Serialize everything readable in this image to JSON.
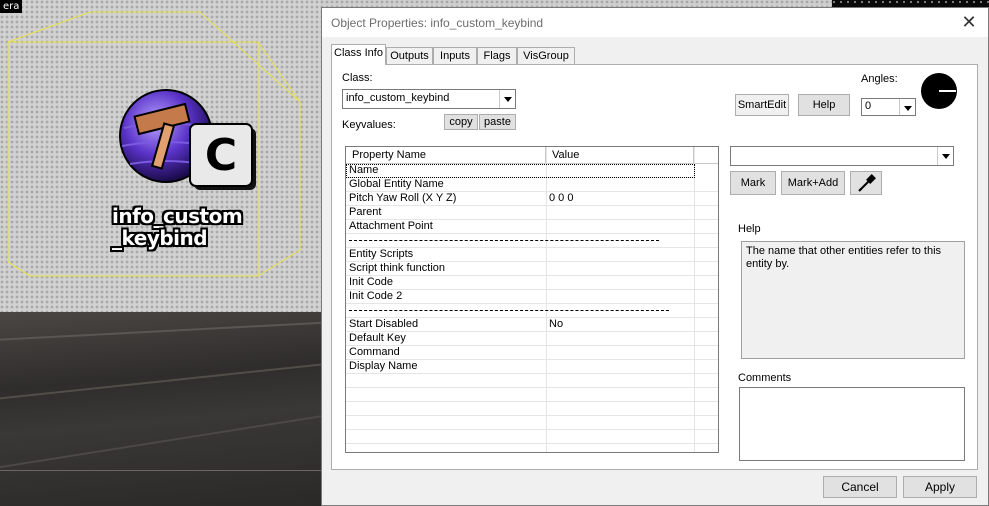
{
  "viewport": {
    "camera_label": "era",
    "entity_label": "info_custom\n_keybind",
    "icon_letter": "C"
  },
  "dialog": {
    "title": "Object Properties: info_custom_keybind",
    "close_label": "✕",
    "tabs": [
      {
        "label": "Class Info"
      },
      {
        "label": "Outputs"
      },
      {
        "label": "Inputs"
      },
      {
        "label": "Flags"
      },
      {
        "label": "VisGroup"
      }
    ],
    "class_label": "Class:",
    "class_value": "info_custom_keybind",
    "keyvalues_label": "Keyvalues:",
    "copy_label": "copy",
    "paste_label": "paste",
    "smartedit_label": "SmartEdit",
    "help_button_label": "Help",
    "angles_label": "Angles:",
    "angles_value": "0",
    "table": {
      "headers": [
        "Property Name",
        "Value"
      ],
      "rows": [
        {
          "name": "Name",
          "value": ""
        },
        {
          "name": "Global Entity Name",
          "value": ""
        },
        {
          "name": "Pitch Yaw Roll (X Y Z)",
          "value": "0 0 0"
        },
        {
          "name": "Parent",
          "value": ""
        },
        {
          "name": "Attachment Point",
          "value": ""
        },
        {
          "sep": true
        },
        {
          "name": "Entity Scripts",
          "value": ""
        },
        {
          "name": "Script think function",
          "value": ""
        },
        {
          "name": "Init Code",
          "value": ""
        },
        {
          "name": "Init Code 2",
          "value": ""
        },
        {
          "sep": true
        },
        {
          "name": "Start Disabled",
          "value": "No"
        },
        {
          "name": "Default Key",
          "value": ""
        },
        {
          "name": "Command",
          "value": ""
        },
        {
          "name": "Display Name",
          "value": ""
        }
      ]
    },
    "value_combo": "",
    "mark_label": "Mark",
    "mark_add_label": "Mark+Add",
    "eyedropper_icon": "eyedropper-icon",
    "help_section_label": "Help",
    "help_text": "The name that other entities refer to this entity by.",
    "comments_label": "Comments",
    "comments_value": "",
    "cancel_label": "Cancel",
    "apply_label": "Apply"
  }
}
